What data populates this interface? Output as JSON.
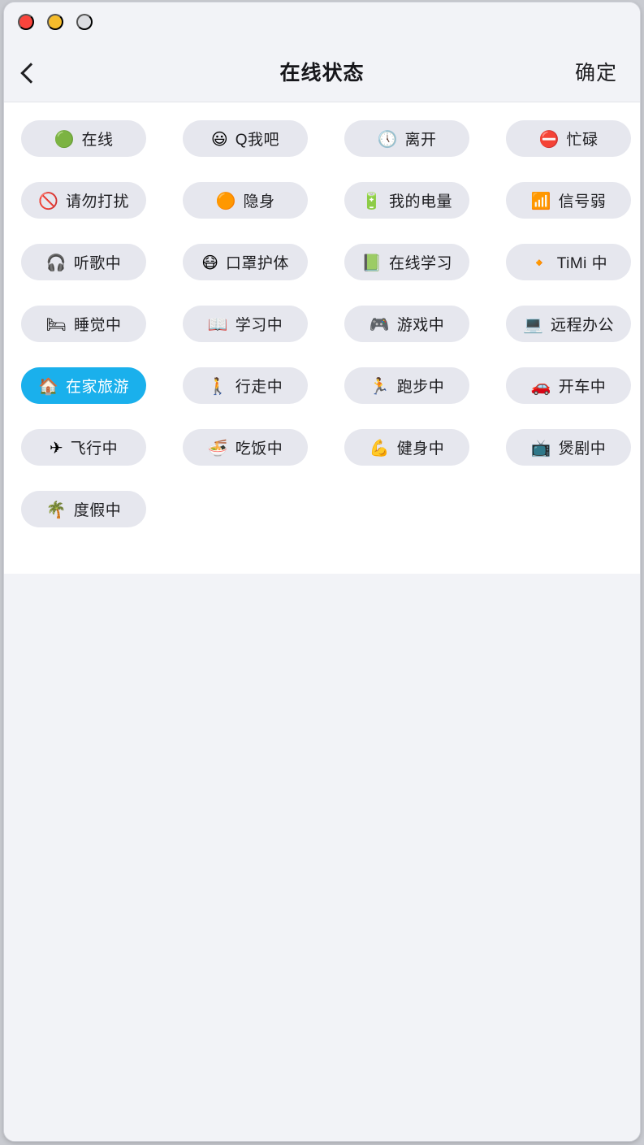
{
  "window": {
    "traffic_lights": [
      {
        "name": "close",
        "color": "#f9443c"
      },
      {
        "name": "minimize",
        "color": "#f5bc2c"
      },
      {
        "name": "zoom",
        "color": "#dcdde1"
      }
    ]
  },
  "header": {
    "back_label": "",
    "title": "在线状态",
    "confirm_label": "确定"
  },
  "colors": {
    "accent": "#1ab0ec",
    "chip_bg": "#e6e7ee",
    "page_bg": "#f2f3f7",
    "panel_bg": "#ffffff",
    "text": "#1d1d20"
  },
  "statuses": [
    {
      "id": "online",
      "icon": "🟢",
      "label": "在线",
      "selected": false
    },
    {
      "id": "q-me",
      "icon": "😃",
      "label": "Q我吧",
      "selected": false
    },
    {
      "id": "away",
      "icon": "🕔",
      "label": "离开",
      "selected": false
    },
    {
      "id": "busy",
      "icon": "⛔",
      "label": "忙碌",
      "selected": false
    },
    {
      "id": "do-not-disturb",
      "icon": "🚫",
      "label": "请勿打扰",
      "selected": false
    },
    {
      "id": "invisible",
      "icon": "🟠",
      "label": "隐身",
      "selected": false
    },
    {
      "id": "my-battery",
      "icon": "🔋",
      "label": "我的电量",
      "selected": false
    },
    {
      "id": "weak-signal",
      "icon": "📶",
      "label": "信号弱",
      "selected": false
    },
    {
      "id": "listening",
      "icon": "🎧",
      "label": "听歌中",
      "selected": false
    },
    {
      "id": "mask-up",
      "icon": "😷",
      "label": "口罩护体",
      "selected": false
    },
    {
      "id": "online-study",
      "icon": "📗",
      "label": "在线学习",
      "selected": false
    },
    {
      "id": "timi",
      "icon": "🔸",
      "label": "TiMi 中",
      "selected": false
    },
    {
      "id": "sleeping",
      "icon": "🛏",
      "label": "睡觉中",
      "selected": false
    },
    {
      "id": "studying",
      "icon": "📖",
      "label": "学习中",
      "selected": false
    },
    {
      "id": "gaming",
      "icon": "🎮",
      "label": "游戏中",
      "selected": false
    },
    {
      "id": "remote-work",
      "icon": "💻",
      "label": "远程办公",
      "selected": false
    },
    {
      "id": "home-travel",
      "icon": "🏠",
      "label": "在家旅游",
      "selected": true
    },
    {
      "id": "walking",
      "icon": "🚶",
      "label": "行走中",
      "selected": false
    },
    {
      "id": "running",
      "icon": "🏃",
      "label": "跑步中",
      "selected": false
    },
    {
      "id": "driving",
      "icon": "🚗",
      "label": "开车中",
      "selected": false
    },
    {
      "id": "flying",
      "icon": "✈",
      "label": "飞行中",
      "selected": false
    },
    {
      "id": "eating",
      "icon": "🍜",
      "label": "吃饭中",
      "selected": false
    },
    {
      "id": "fitness",
      "icon": "💪",
      "label": "健身中",
      "selected": false
    },
    {
      "id": "binge-watching",
      "icon": "📺",
      "label": "煲剧中",
      "selected": false
    },
    {
      "id": "vacation",
      "icon": "🌴",
      "label": "度假中",
      "selected": false
    }
  ]
}
